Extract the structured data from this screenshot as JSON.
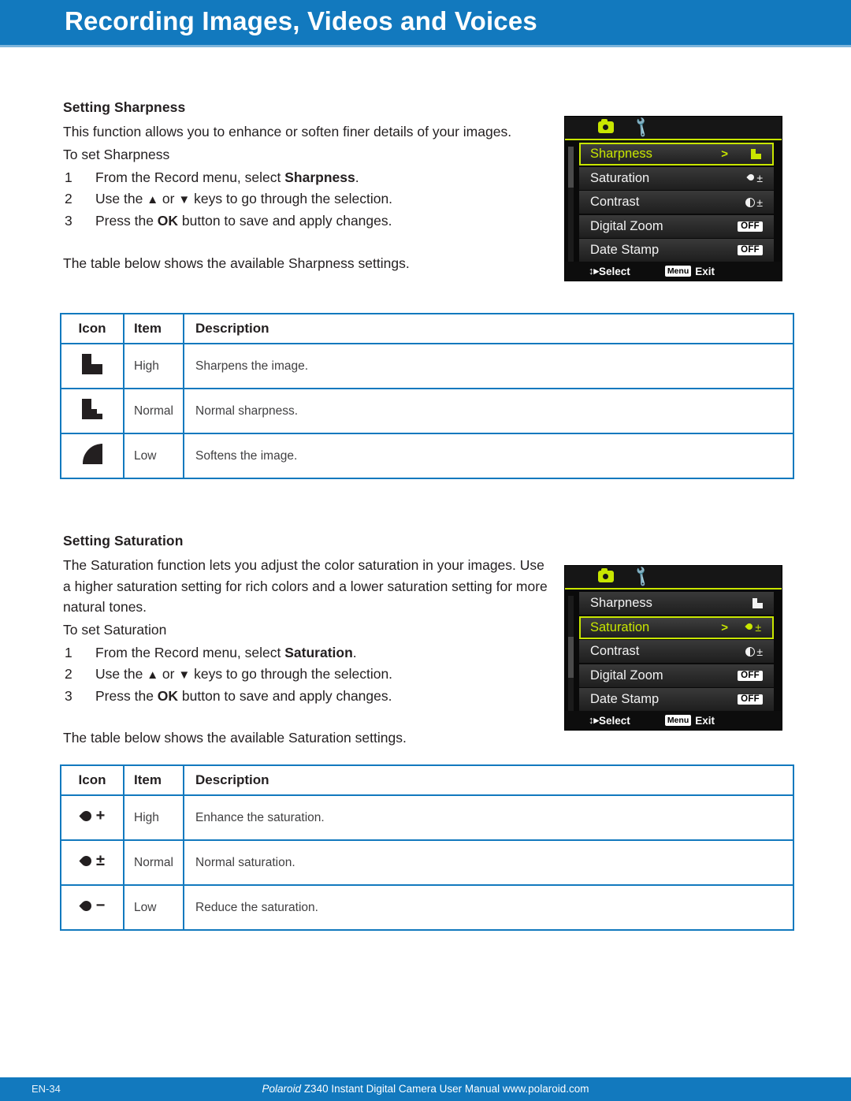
{
  "header": {
    "title": "Recording Images, Videos and Voices",
    "bar_color": "#1279be"
  },
  "sharpness_section": {
    "heading": "Setting Sharpness",
    "intro": "This function allows you to enhance or soften finer details of your images.",
    "to_set": "To set Sharpness",
    "steps": [
      {
        "num": "1",
        "text_before": "From the Record menu, select ",
        "bold": "Sharpness",
        "text_after": "."
      },
      {
        "num": "2",
        "text_before": "Use the ",
        "bold": "",
        "text_after": " keys to go through the selection."
      },
      {
        "num": "3",
        "text_before": "Press the ",
        "bold": "OK",
        "text_after": " button to save and apply changes."
      }
    ],
    "table_note": "The table below shows the available Sharpness settings."
  },
  "sharpness_lcd": {
    "tab_camera_icon": "camera-icon",
    "tab_wrench_icon": "wrench-icon",
    "rows": [
      {
        "label": "Sharpness",
        "selected": true,
        "arrow": ">",
        "value_icon": "sharpness-glyph",
        "value_text": ""
      },
      {
        "label": "Saturation",
        "selected": false,
        "arrow": "",
        "value_icon": "saturation-glyph",
        "value_text": "±"
      },
      {
        "label": "Contrast",
        "selected": false,
        "arrow": "",
        "value_icon": "contrast-glyph",
        "value_text": "±"
      },
      {
        "label": "Digital Zoom",
        "selected": false,
        "arrow": "",
        "value_icon": "off-badge",
        "value_text": "OFF"
      },
      {
        "label": "Date Stamp",
        "selected": false,
        "arrow": "",
        "value_icon": "off-badge",
        "value_text": "OFF"
      }
    ],
    "footer": {
      "updown_icon": "up-down-arrow-icon",
      "select_label": "Select",
      "menu_key": "Menu",
      "exit_label": "Exit"
    },
    "accent_color": "#c8e600"
  },
  "sharpness_table": {
    "headers": {
      "icon": "Icon",
      "item": "Item",
      "description": "Description"
    },
    "rows": [
      {
        "icon": "sharpness-high-icon",
        "item": "High",
        "description": "Sharpens the image."
      },
      {
        "icon": "sharpness-normal-icon",
        "item": "Normal",
        "description": "Normal sharpness."
      },
      {
        "icon": "sharpness-low-icon",
        "item": "Low",
        "description": "Softens the image."
      }
    ]
  },
  "saturation_section": {
    "heading": "Setting Saturation",
    "intro": "The Saturation function lets you adjust the color saturation in your images. Use a higher saturation setting for rich colors and a lower saturation setting for more natural tones.",
    "to_set": "To set Saturation",
    "steps": [
      {
        "num": "1",
        "text_before": "From the Record menu, select ",
        "bold": "Saturation",
        "text_after": "."
      },
      {
        "num": "2",
        "text_before": "Use the ",
        "bold": "",
        "text_after": " keys to go through the selection."
      },
      {
        "num": "3",
        "text_before": "Press the ",
        "bold": "OK",
        "text_after": " button to save and apply changes."
      }
    ],
    "table_note": "The table below shows the available Saturation settings."
  },
  "saturation_lcd": {
    "tab_camera_icon": "camera-icon",
    "tab_wrench_icon": "wrench-icon",
    "rows": [
      {
        "label": "Sharpness",
        "selected": false,
        "arrow": "",
        "value_icon": "sharpness-glyph",
        "value_text": ""
      },
      {
        "label": "Saturation",
        "selected": true,
        "arrow": ">",
        "value_icon": "saturation-glyph",
        "value_text": "±"
      },
      {
        "label": "Contrast",
        "selected": false,
        "arrow": "",
        "value_icon": "contrast-glyph",
        "value_text": "±"
      },
      {
        "label": "Digital Zoom",
        "selected": false,
        "arrow": "",
        "value_icon": "off-badge",
        "value_text": "OFF"
      },
      {
        "label": "Date Stamp",
        "selected": false,
        "arrow": "",
        "value_icon": "off-badge",
        "value_text": "OFF"
      }
    ],
    "footer": {
      "updown_icon": "up-down-arrow-icon",
      "select_label": "Select",
      "menu_key": "Menu",
      "exit_label": "Exit"
    },
    "accent_color": "#c8e600"
  },
  "saturation_table": {
    "headers": {
      "icon": "Icon",
      "item": "Item",
      "description": "Description"
    },
    "rows": [
      {
        "icon": "saturation-high-icon",
        "sign": "+",
        "item": "High",
        "description": "Enhance the saturation."
      },
      {
        "icon": "saturation-normal-icon",
        "sign": "±",
        "item": "Normal",
        "description": "Normal saturation."
      },
      {
        "icon": "saturation-low-icon",
        "sign": "−",
        "item": "Low",
        "description": "Reduce the saturation."
      }
    ]
  },
  "footer": {
    "page_number": "EN-34",
    "brand": "Polaroid",
    "manual_line": " Z340 Instant Digital Camera User Manual www.polaroid.com"
  },
  "glyphs": {
    "up_triangle": "▲",
    "down_triangle": "▼",
    "or_word": "or",
    "updown": "↕▸",
    "chevron": ">"
  }
}
